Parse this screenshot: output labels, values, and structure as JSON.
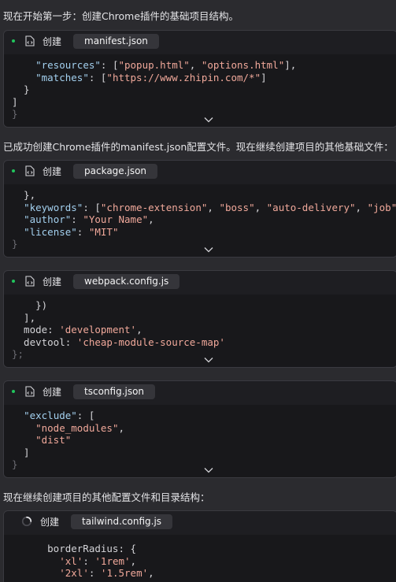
{
  "paragraphs": [
    "现在开始第一步：创建Chrome插件的基础项目结构。",
    "已成功创建Chrome插件的manifest.json配置文件。现在继续创建项目的其他基础文件：",
    "现在继续创建项目的其他配置文件和目录结构："
  ],
  "blocks": [
    {
      "action": "创建",
      "filename": "manifest.json",
      "lines": [
        "    \"resources\": [\"popup.html\", \"options.html\"],",
        "    \"matches\": [\"https://www.zhipin.com/*\"]",
        "  }",
        "]",
        "}"
      ]
    },
    {
      "action": "创建",
      "filename": "package.json",
      "lines": [
        "  },",
        "  \"keywords\": [\"chrome-extension\", \"boss\", \"auto-delivery\", \"job\"],",
        "  \"author\": \"Your Name\",",
        "  \"license\": \"MIT\"",
        "}"
      ]
    },
    {
      "action": "创建",
      "filename": "webpack.config.js",
      "lines": [
        "    })",
        "  ],",
        "  mode: 'development',",
        "  devtool: 'cheap-module-source-map'",
        "};"
      ]
    },
    {
      "action": "创建",
      "filename": "tsconfig.json",
      "lines": [
        "  \"exclude\": [",
        "    \"node_modules\",",
        "    \"dist\"",
        "  ]",
        "}"
      ]
    },
    {
      "action": "创建",
      "filename": "tailwind.config.js",
      "lines": [
        "      borderRadius: {",
        "        'xl': '1rem',",
        "        '2xl': '1.5rem',"
      ]
    }
  ],
  "icons": {
    "status_done": "green-dot-icon",
    "file": "file-code-icon",
    "loading": "spinner-icon",
    "expand": "chevron-down-icon"
  },
  "colors": {
    "background": "#2b2b2f",
    "code_background": "#18181b",
    "status_green": "#21c55d",
    "json_key": "#a3d0ef",
    "string": "#f0a89a"
  }
}
